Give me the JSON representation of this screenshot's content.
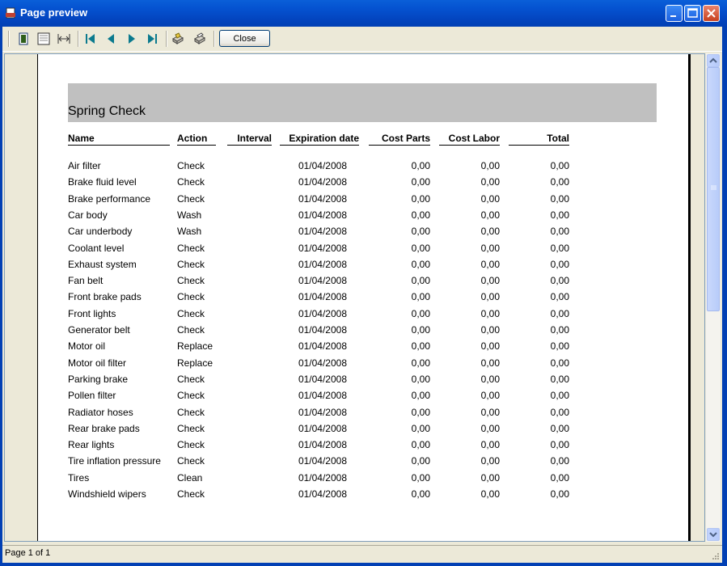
{
  "window": {
    "title": "Page preview"
  },
  "toolbar": {
    "close_label": "Close"
  },
  "report": {
    "title": "Spring Check",
    "headers": {
      "name": "Name",
      "action": "Action",
      "interval": "Interval",
      "expiration": "Expiration date",
      "cost_parts": "Cost Parts",
      "cost_labor": "Cost Labor",
      "total": "Total"
    },
    "rows": [
      {
        "name": "Air filter",
        "action": "Check",
        "date": "01/04/2008",
        "parts": "0,00",
        "labor": "0,00",
        "total": "0,00"
      },
      {
        "name": "Brake fluid level",
        "action": "Check",
        "date": "01/04/2008",
        "parts": "0,00",
        "labor": "0,00",
        "total": "0,00"
      },
      {
        "name": "Brake performance",
        "action": "Check",
        "date": "01/04/2008",
        "parts": "0,00",
        "labor": "0,00",
        "total": "0,00"
      },
      {
        "name": "Car body",
        "action": "Wash",
        "date": "01/04/2008",
        "parts": "0,00",
        "labor": "0,00",
        "total": "0,00"
      },
      {
        "name": "Car underbody",
        "action": "Wash",
        "date": "01/04/2008",
        "parts": "0,00",
        "labor": "0,00",
        "total": "0,00"
      },
      {
        "name": "Coolant level",
        "action": "Check",
        "date": "01/04/2008",
        "parts": "0,00",
        "labor": "0,00",
        "total": "0,00"
      },
      {
        "name": "Exhaust system",
        "action": "Check",
        "date": "01/04/2008",
        "parts": "0,00",
        "labor": "0,00",
        "total": "0,00"
      },
      {
        "name": "Fan belt",
        "action": "Check",
        "date": "01/04/2008",
        "parts": "0,00",
        "labor": "0,00",
        "total": "0,00"
      },
      {
        "name": "Front brake pads",
        "action": "Check",
        "date": "01/04/2008",
        "parts": "0,00",
        "labor": "0,00",
        "total": "0,00"
      },
      {
        "name": "Front lights",
        "action": "Check",
        "date": "01/04/2008",
        "parts": "0,00",
        "labor": "0,00",
        "total": "0,00"
      },
      {
        "name": "Generator belt",
        "action": "Check",
        "date": "01/04/2008",
        "parts": "0,00",
        "labor": "0,00",
        "total": "0,00"
      },
      {
        "name": "Motor oil",
        "action": "Replace",
        "date": "01/04/2008",
        "parts": "0,00",
        "labor": "0,00",
        "total": "0,00"
      },
      {
        "name": "Motor oil filter",
        "action": "Replace",
        "date": "01/04/2008",
        "parts": "0,00",
        "labor": "0,00",
        "total": "0,00"
      },
      {
        "name": "Parking brake",
        "action": "Check",
        "date": "01/04/2008",
        "parts": "0,00",
        "labor": "0,00",
        "total": "0,00"
      },
      {
        "name": "Pollen filter",
        "action": "Check",
        "date": "01/04/2008",
        "parts": "0,00",
        "labor": "0,00",
        "total": "0,00"
      },
      {
        "name": "Radiator hoses",
        "action": "Check",
        "date": "01/04/2008",
        "parts": "0,00",
        "labor": "0,00",
        "total": "0,00"
      },
      {
        "name": "Rear brake pads",
        "action": "Check",
        "date": "01/04/2008",
        "parts": "0,00",
        "labor": "0,00",
        "total": "0,00"
      },
      {
        "name": "Rear lights",
        "action": "Check",
        "date": "01/04/2008",
        "parts": "0,00",
        "labor": "0,00",
        "total": "0,00"
      },
      {
        "name": "Tire inflation pressure",
        "action": "Check",
        "date": "01/04/2008",
        "parts": "0,00",
        "labor": "0,00",
        "total": "0,00"
      },
      {
        "name": "Tires",
        "action": "Clean",
        "date": "01/04/2008",
        "parts": "0,00",
        "labor": "0,00",
        "total": "0,00"
      },
      {
        "name": "Windshield wipers",
        "action": "Check",
        "date": "01/04/2008",
        "parts": "0,00",
        "labor": "0,00",
        "total": "0,00"
      }
    ]
  },
  "status": {
    "page": "Page 1 of 1"
  }
}
